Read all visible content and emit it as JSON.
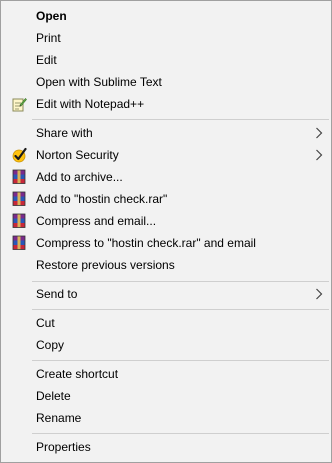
{
  "menu": {
    "items": [
      {
        "label": "Open"
      },
      {
        "label": "Print"
      },
      {
        "label": "Edit"
      },
      {
        "label": "Open with Sublime Text"
      },
      {
        "label": "Edit with Notepad++",
        "icon": "notepad-plus-plus-icon"
      },
      {
        "label": "Share with",
        "submenu": true
      },
      {
        "label": "Norton Security",
        "icon": "norton-check-icon",
        "submenu": true
      },
      {
        "label": "Add to archive...",
        "icon": "winrar-icon"
      },
      {
        "label": "Add to \"hostin check.rar\"",
        "icon": "winrar-icon"
      },
      {
        "label": "Compress and email...",
        "icon": "winrar-icon"
      },
      {
        "label": "Compress to \"hostin check.rar\" and email",
        "icon": "winrar-icon"
      },
      {
        "label": "Restore previous versions"
      },
      {
        "label": "Send to",
        "submenu": true
      },
      {
        "label": "Cut"
      },
      {
        "label": "Copy"
      },
      {
        "label": "Create shortcut"
      },
      {
        "label": "Delete"
      },
      {
        "label": "Rename"
      },
      {
        "label": "Properties"
      }
    ]
  },
  "colors": {
    "background": "#f2f2f2",
    "border": "#a0a0a0",
    "separator": "#cfcfcf",
    "text": "#000000"
  }
}
